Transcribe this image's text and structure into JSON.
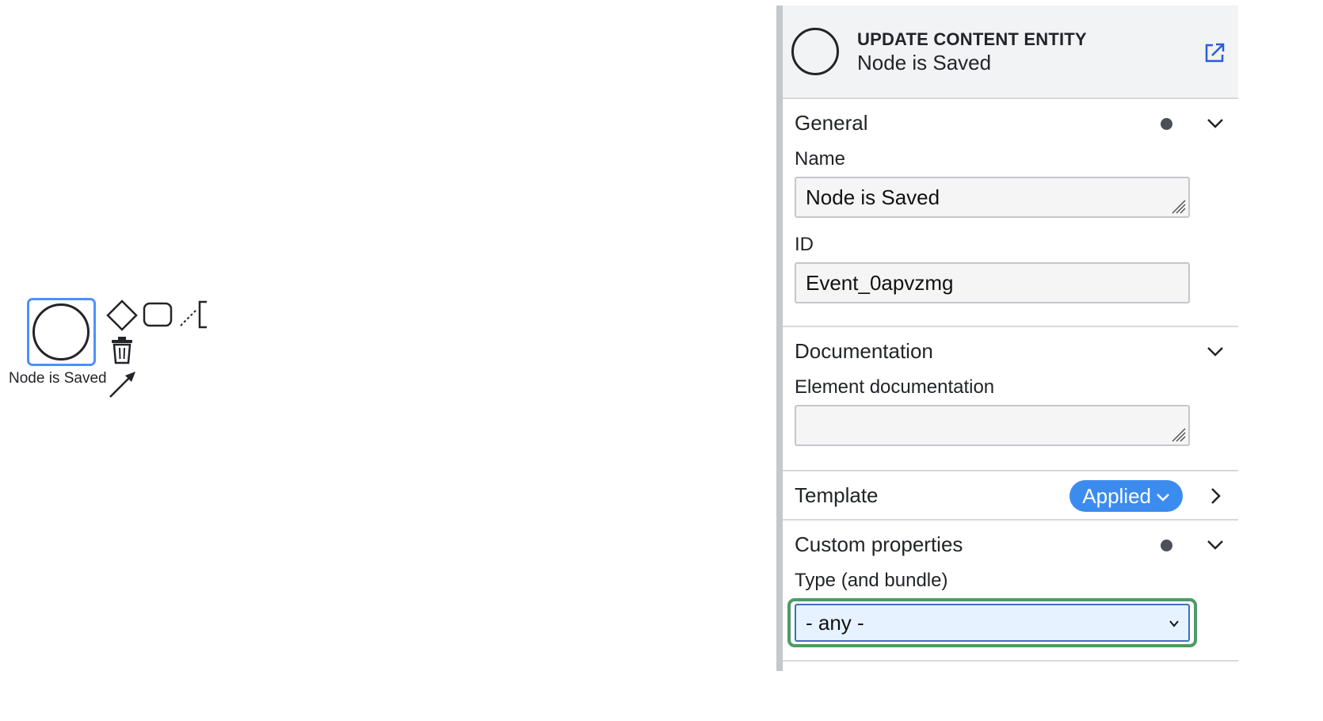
{
  "canvas": {
    "event": {
      "label": "Node is Saved"
    },
    "context_pad": {
      "items": [
        "gateway-icon",
        "task-icon",
        "text-annotation-icon",
        "delete-icon",
        "connect-arrow-icon"
      ]
    }
  },
  "panel": {
    "header": {
      "type": "UPDATE CONTENT ENTITY",
      "name": "Node is Saved",
      "link_icon": "open-external-icon"
    },
    "groups": {
      "general": {
        "title": "General",
        "name_label": "Name",
        "name_value": "Node is Saved",
        "id_label": "ID",
        "id_value": "Event_0apvzmg"
      },
      "documentation": {
        "title": "Documentation",
        "doc_label": "Element documentation",
        "doc_value": ""
      },
      "template": {
        "title": "Template",
        "badge": "Applied"
      },
      "custom": {
        "title": "Custom properties",
        "type_label": "Type (and bundle)",
        "type_value": "- any -"
      }
    }
  },
  "colors": {
    "selection": "#4d90fe",
    "badge": "#3c8cf0",
    "highlight": "#4e9a68",
    "select_bg": "#e6f2ff"
  }
}
